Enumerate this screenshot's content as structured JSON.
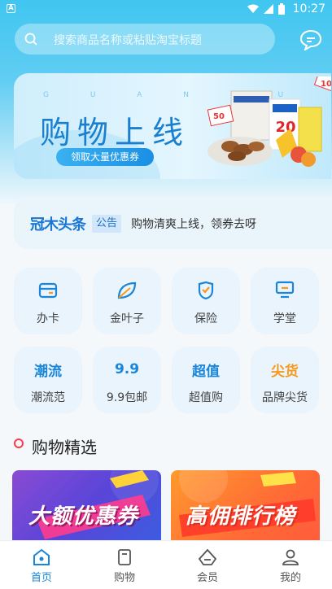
{
  "status_bar": {
    "time": "10:27",
    "app_badge": "A"
  },
  "search": {
    "placeholder": "搜索商品名称或粘贴淘宝标题"
  },
  "banner": {
    "brand_letters": "G U A N M U",
    "title": "购物上线",
    "cta": "领取大量优惠券",
    "tag_50": "50",
    "tag_20": "20",
    "tag_10": "10"
  },
  "notice": {
    "logo": "冠木头条",
    "tag": "公告",
    "text": "购物清爽上线，领券去呀"
  },
  "grid": [
    {
      "label": "办卡",
      "icon": "card-icon"
    },
    {
      "label": "金叶子",
      "icon": "leaf-icon"
    },
    {
      "label": "保险",
      "icon": "shield-icon"
    },
    {
      "label": "学堂",
      "icon": "monitor-icon"
    },
    {
      "label": "潮流范",
      "icon_text": "潮流"
    },
    {
      "label": "9.9包邮",
      "icon_text": "9.9"
    },
    {
      "label": "超值购",
      "icon_text": "超值"
    },
    {
      "label": "品牌尖货",
      "icon_text": "尖货"
    }
  ],
  "section": {
    "title": "购物精选"
  },
  "promos": [
    {
      "text": "大额优惠券"
    },
    {
      "text": "高佣排行榜"
    }
  ],
  "tabs": [
    {
      "label": "首页",
      "icon": "home-icon",
      "active": true
    },
    {
      "label": "购物",
      "icon": "bag-icon",
      "active": false
    },
    {
      "label": "会员",
      "icon": "vip-icon",
      "active": false
    },
    {
      "label": "我的",
      "icon": "person-icon",
      "active": false
    }
  ],
  "colors": {
    "accent": "#1a86d9",
    "orange": "#f59a1c",
    "red_dot": "#ff3b4b"
  }
}
